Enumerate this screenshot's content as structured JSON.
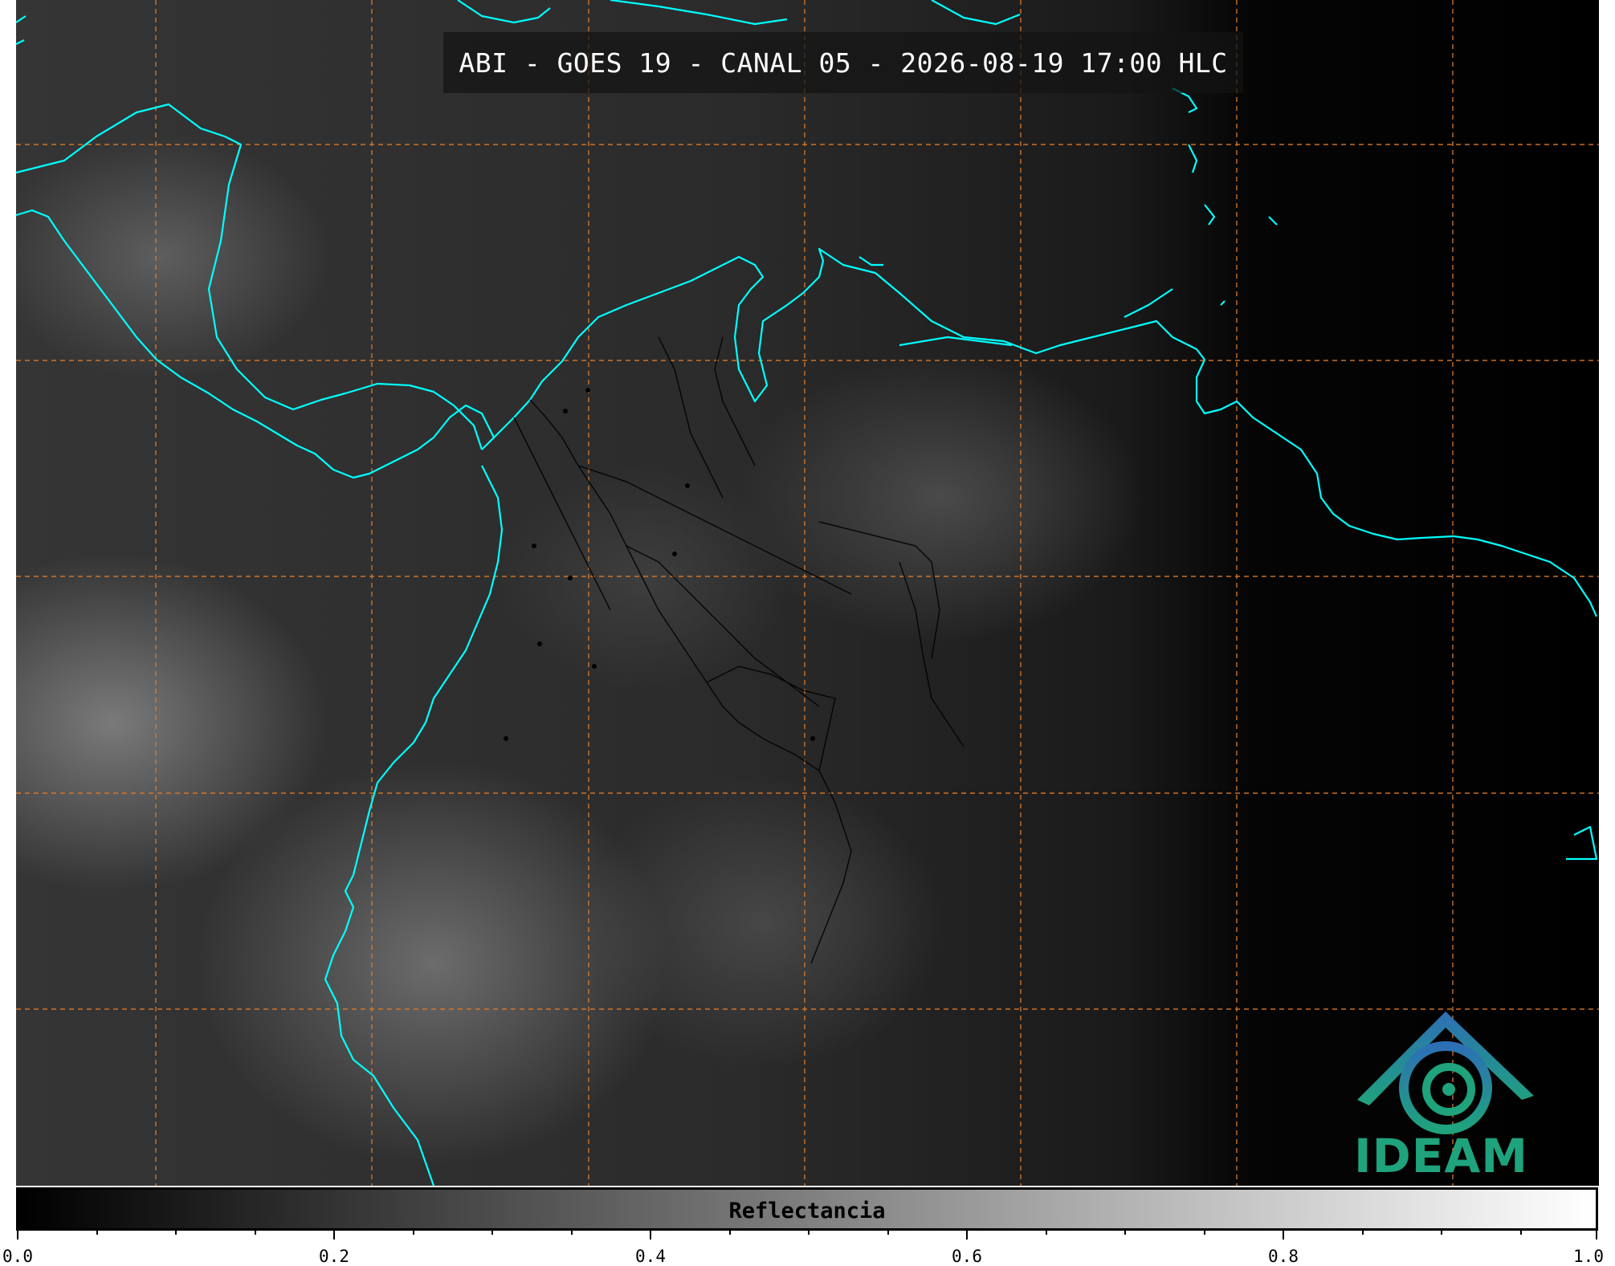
{
  "title": "ABI - GOES 19 - CANAL 05 - 2026-08-19 17:00 HLC",
  "logo": {
    "name": "ideam-logo",
    "text": "IDEAM",
    "colors": {
      "blue": "#2d6fb5",
      "green": "#1fa37c"
    }
  },
  "colorbar": {
    "label": "Reflectancia",
    "range": [
      0.0,
      1.0
    ],
    "colormap": "grayscale",
    "tick_labels": [
      "0.0",
      "0.2",
      "0.4",
      "0.6",
      "0.8",
      "1.0"
    ]
  },
  "map": {
    "coastline_color": "#00ffff",
    "borders_color": "#000000",
    "grid_color": "#e07b2a",
    "grid_style": "dashed"
  }
}
